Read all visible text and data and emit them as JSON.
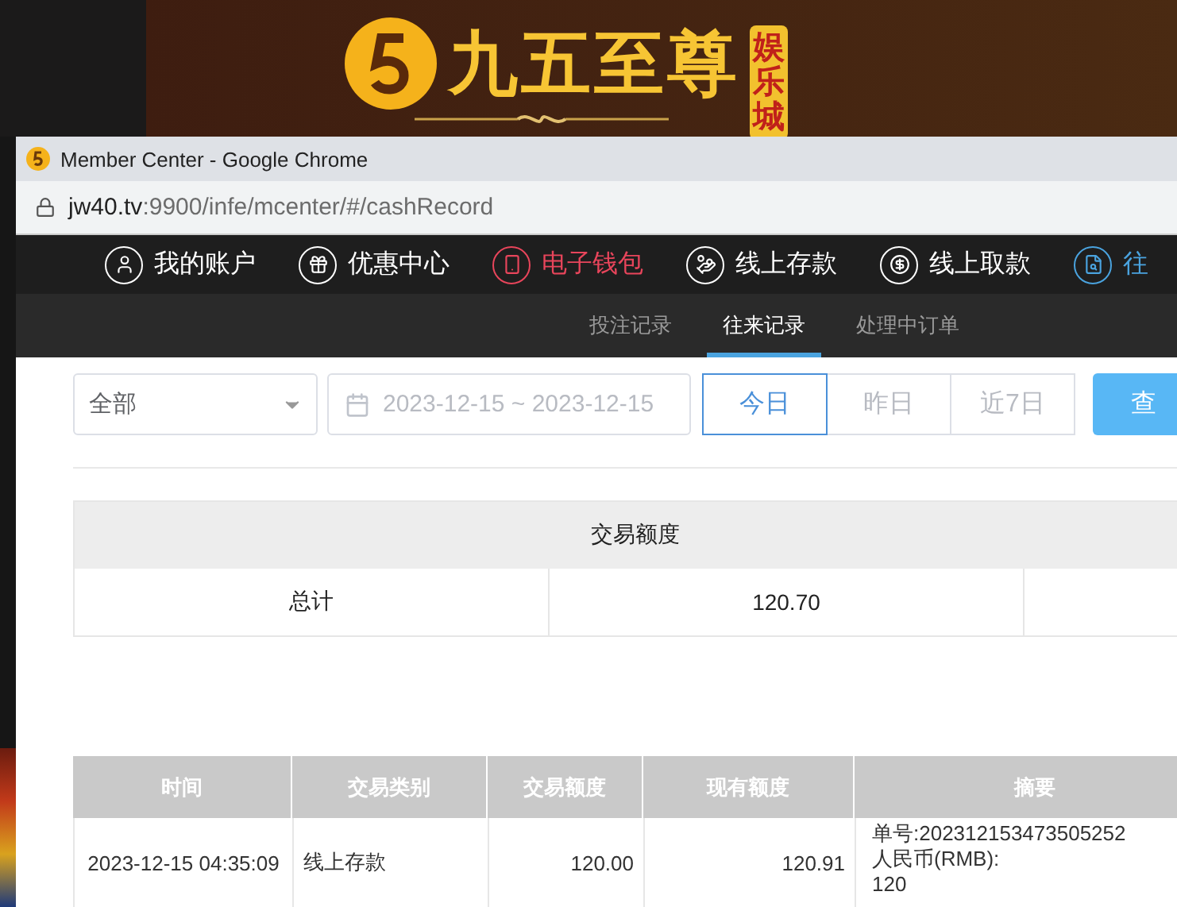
{
  "site_header": {
    "logo_text": "九五至尊",
    "logo_badge": "娱乐城"
  },
  "window": {
    "title": "Member Center - Google Chrome",
    "address_host": "jw40.tv",
    "address_path": ":9900/infe/mcenter/#/cashRecord"
  },
  "nav": [
    {
      "label": "我的账户",
      "color": "#ffffff"
    },
    {
      "label": "优惠中心",
      "color": "#ffffff"
    },
    {
      "label": "电子钱包",
      "color": "#e8455b"
    },
    {
      "label": "线上存款",
      "color": "#ffffff"
    },
    {
      "label": "线上取款",
      "color": "#ffffff"
    },
    {
      "label": "往",
      "color": "#4aa3df"
    }
  ],
  "subtabs": [
    {
      "label": "投注记录",
      "selected": false
    },
    {
      "label": "往来记录",
      "selected": true
    },
    {
      "label": "处理中订单",
      "selected": false
    }
  ],
  "filter": {
    "type_select": "全部",
    "date_range": "2023-12-15 ~ 2023-12-15",
    "quick_ranges": [
      {
        "label": "今日",
        "selected": true
      },
      {
        "label": "昨日",
        "selected": false
      },
      {
        "label": "近7日",
        "selected": false
      }
    ],
    "query_button": "查"
  },
  "summary": {
    "header": "交易额度",
    "row": [
      "总计",
      "120.70"
    ]
  },
  "table": {
    "columns": [
      "时间",
      "交易类别",
      "交易额度",
      "现有额度",
      "摘要"
    ],
    "rows": [
      {
        "time": "2023-12-15 04:35:09",
        "type": "线上存款",
        "amount": "120.00",
        "balance": "120.91",
        "summary": [
          "单号:202312153473505252",
          "人民币(RMB):",
          "120"
        ]
      }
    ]
  }
}
